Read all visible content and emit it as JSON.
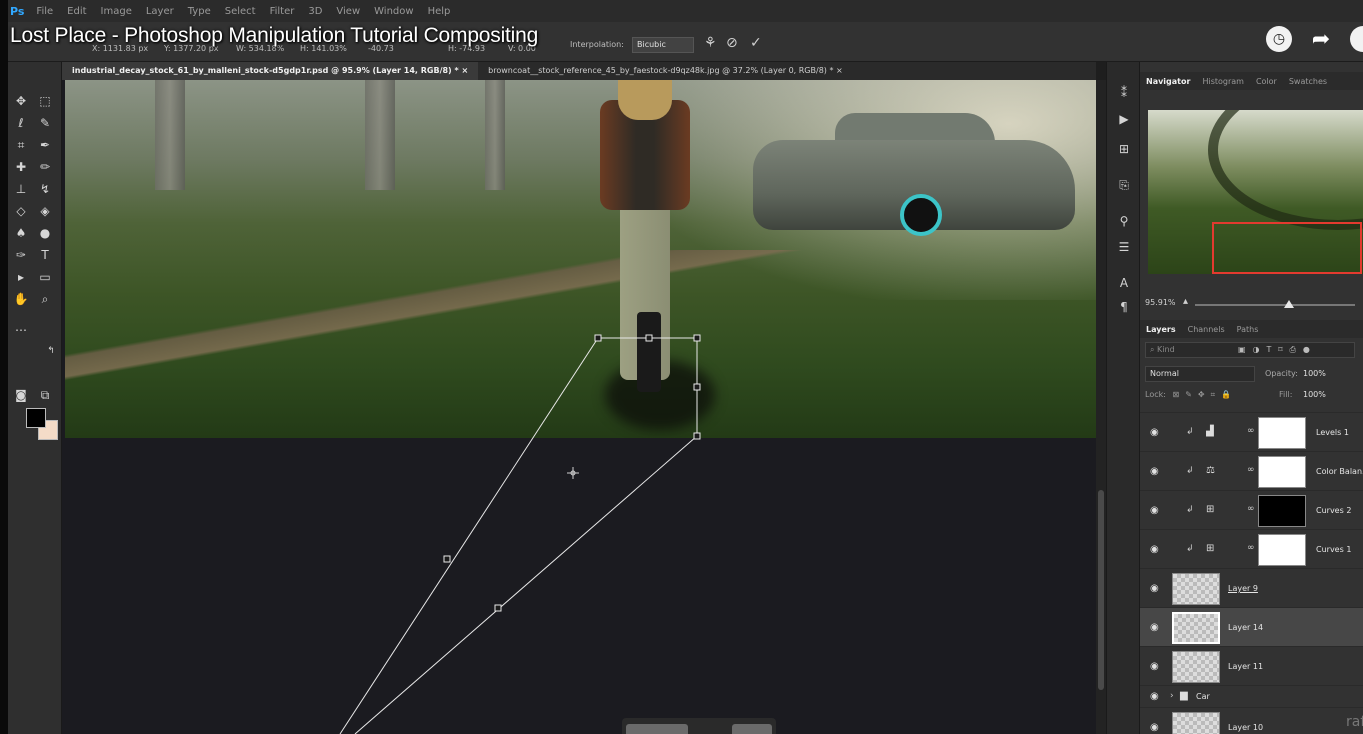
{
  "video_title": "Lost Place - Photoshop Manipulation Tutorial Compositing",
  "menubar": {
    "logo": "Ps",
    "items": [
      "File",
      "Edit",
      "Image",
      "Layer",
      "Type",
      "Select",
      "Filter",
      "3D",
      "View",
      "Window",
      "Help"
    ]
  },
  "options_bar": {
    "x_value": "X: 1131.83 px",
    "y_value": "Y: 1377.20 px",
    "w_value": "W: 534.18%",
    "h_value": "H: 141.03%",
    "angle_value": "-40.73",
    "hskew_value": "H: -74.93",
    "vskew_value": "V: 0.00",
    "interpolation_label": "Interpolation:",
    "interpolation_value": "Bicubic"
  },
  "document_tabs": [
    "industrial_decay_stock_61_by_malleni_stock-d5gdp1r.psd @ 95.9% (Layer 14, RGB/8) * ×",
    "browncoat__stock_reference_45_by_faestock-d9qz48k.jpg @ 37.2% (Layer 0, RGB/8) * ×"
  ],
  "panels": {
    "navigator_tabs": [
      "Navigator",
      "Histogram",
      "Color",
      "Swatches"
    ],
    "zoom_value": "95.91%",
    "zoom_fraction": 0.59,
    "layers_tabs": [
      "Layers",
      "Channels",
      "Paths"
    ],
    "filter_placeholder": "Kind",
    "blend_mode": "Normal",
    "opacity_label": "Opacity:",
    "opacity_value": "100%",
    "lock_label": "Lock:",
    "fill_label": "Fill:",
    "fill_value": "100%"
  },
  "layers": [
    {
      "name": "Levels 1",
      "kind": "adjustment",
      "icon": "levels-icon",
      "mask": "white"
    },
    {
      "name": "Color Balan...",
      "kind": "adjustment",
      "icon": "color-balance-icon",
      "mask": "white"
    },
    {
      "name": "Curves 2",
      "kind": "adjustment",
      "icon": "curves-icon",
      "mask": "black"
    },
    {
      "name": "Curves 1",
      "kind": "adjustment",
      "icon": "curves-icon",
      "mask": "white"
    },
    {
      "name": "Layer 9",
      "kind": "pixel",
      "underlined": true
    },
    {
      "name": "Layer 14",
      "kind": "pixel",
      "selected": true
    },
    {
      "name": "Layer 11",
      "kind": "pixel"
    },
    {
      "name": "Car",
      "kind": "group"
    },
    {
      "name": "Layer 10",
      "kind": "pixel"
    }
  ],
  "colors": {
    "foreground": "#000000",
    "background": "#f4dcc8",
    "navigator_box": "#e33a2f",
    "accent": "#31a8ff"
  },
  "watermark": "raf"
}
